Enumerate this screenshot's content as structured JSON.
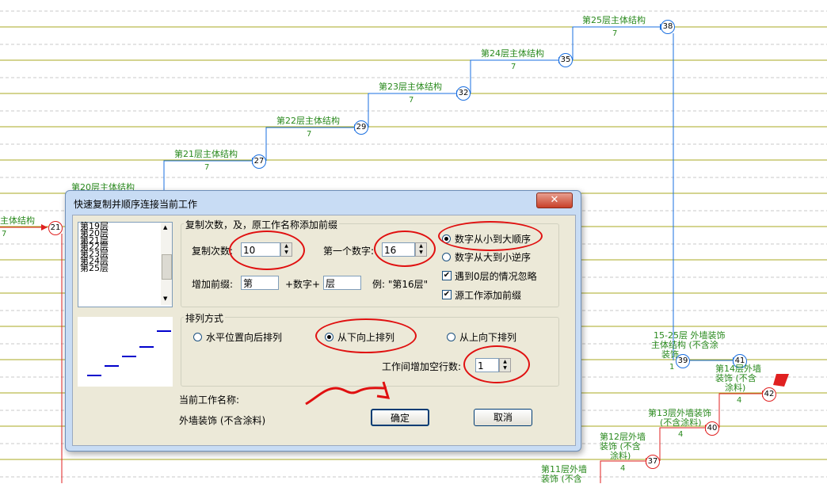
{
  "background": {
    "tasks": [
      {
        "label": "主体结构",
        "duration": "7",
        "node": "21"
      },
      {
        "label": "第20层主体结构",
        "duration": ""
      },
      {
        "label": "第21层主体结构",
        "duration": "7",
        "node": "27"
      },
      {
        "label": "第22层主体结构",
        "duration": "7",
        "node": "29"
      },
      {
        "label": "第23层主体结构",
        "duration": "7",
        "node": "32"
      },
      {
        "label": "第24层主体结构",
        "duration": "7",
        "node": "35"
      },
      {
        "label": "第25层主体结构",
        "duration": "7",
        "node": "38"
      }
    ],
    "right_labels": {
      "t1525_a": "15-25层 外墙装饰",
      "t1525_b": "主体结构 (不含涂",
      "t1525_c": "装饰",
      "t1525_d": "1",
      "node39": "39",
      "node41": "41",
      "t14_a": "第14层外墙",
      "t14_b": "装饰 (不含",
      "t14_c": "涂料)",
      "t14_dur": "4",
      "node42": "42",
      "t13_a": "第13层外墙装饰",
      "t13_b": "(不含涂料)",
      "t13_dur": "4",
      "node40": "40",
      "t12_a": "第12层外墙",
      "t12_b": "装饰 (不含",
      "t12_c": "涂料)",
      "t12_dur": "4",
      "node37": "37",
      "t11_a": "第11层外墙",
      "t11_b": "装饰 (不含",
      "dur4": "4"
    }
  },
  "dialog": {
    "title": "快速复制并顺序连接当前工作",
    "close": "✕",
    "list_items": [
      "第19层",
      "第20层",
      "第21层",
      "第22层",
      "第23层",
      "第24层",
      "第25层"
    ],
    "copy_group": {
      "title": "复制次数，及，原工作名称添加前缀",
      "copies_label": "复制次数:",
      "copies_value": "10",
      "first_num_label": "第一个数字:",
      "first_num_value": "16",
      "prefix_label": "增加前缀:",
      "prefix_value": "第",
      "plus_num": "+数字+",
      "suffix_value": "层",
      "example": "例: \"第16层\"",
      "asc": "数字从小到大顺序",
      "desc": "数字从大到小逆序",
      "ignore_zero": "遇到0层的情况忽略",
      "add_prefix": "源工作添加前缀"
    },
    "arrange_group": {
      "title": "排列方式",
      "opt1": "水平位置向后排列",
      "opt2": "从下向上排列",
      "opt3": "从上向下排列",
      "blank_rows_label": "工作间增加空行数:",
      "blank_rows_value": "1"
    },
    "current_name_label": "当前工作名称:",
    "current_name_value": "外墙装饰 (不含涂料)",
    "ok": "确定",
    "cancel": "取消"
  }
}
